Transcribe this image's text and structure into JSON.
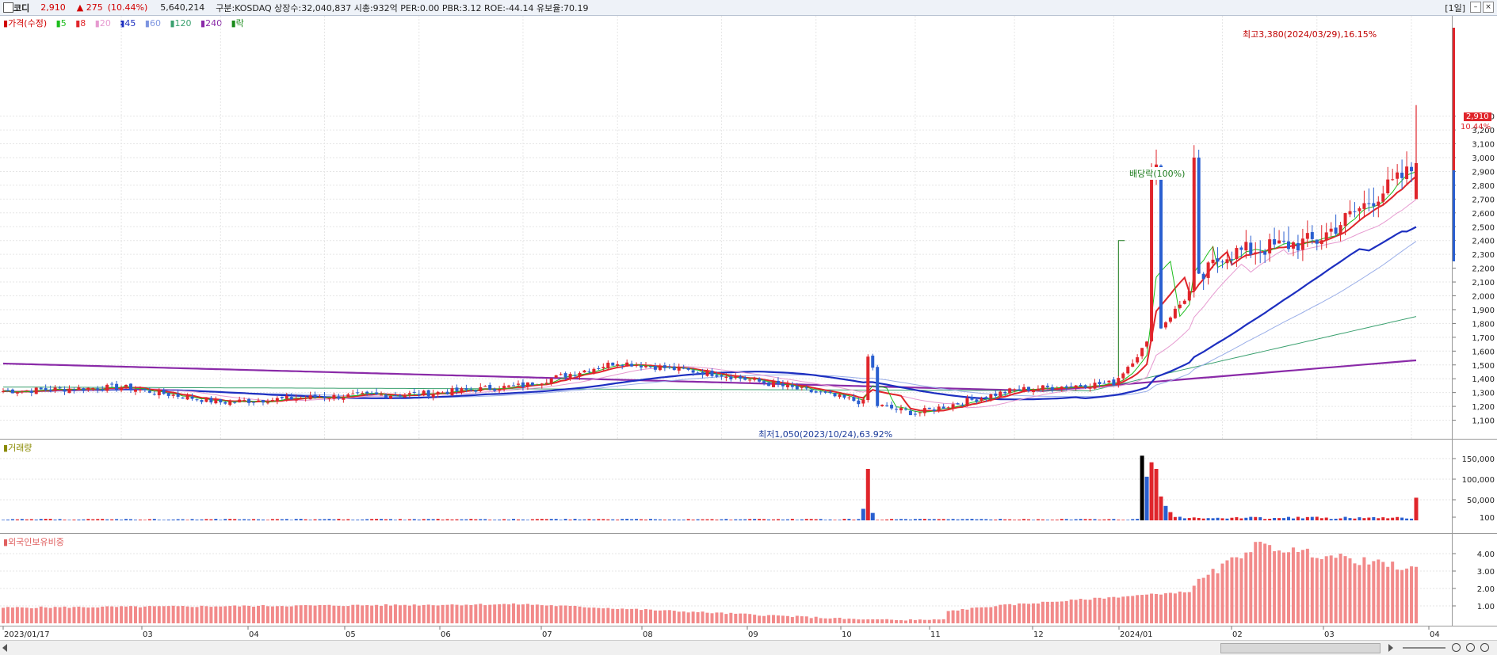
{
  "window": {
    "name": "코디",
    "price": "2,910",
    "change": "▲ 275",
    "change_pct": "(10.44%)",
    "volume": "5,640,214",
    "info": "구분:KOSDAQ 상장수:32,040,837 시총:932억 PER:0.00 PBR:3.12 ROE:-44.14 유보율:70.19",
    "period_button": "[1일]"
  },
  "legend": {
    "price_label": "가격(수정)",
    "ma": [
      {
        "label": "5",
        "color": "#1cbd1c"
      },
      {
        "label": "8",
        "color": "#e0252b"
      },
      {
        "label": "20",
        "color": "#e69ad0"
      },
      {
        "label": "45",
        "color": "#1d2fc0"
      },
      {
        "label": "60",
        "color": "#9aaee8"
      },
      {
        "label": "120",
        "color": "#3aa06f"
      },
      {
        "label": "240",
        "color": "#8a2aa8"
      }
    ],
    "ex_label": "락",
    "volume_label": "거래량",
    "foreign_label": "외국인보유비중"
  },
  "annotations": {
    "high": "최고3,380(2024/03/29),16.15%",
    "low": "최저1,050(2023/10/24),63.92%",
    "dividend": "배당락(100%)",
    "current_price": "2,910",
    "current_pct": "10.44%"
  },
  "x_labels": [
    "2023/01/17",
    "03",
    "04",
    "05",
    "06",
    "07",
    "08",
    "09",
    "10",
    "11",
    "12",
    "2024/01",
    "02",
    "03",
    "04"
  ],
  "colors": {
    "up": "#e0252b",
    "down": "#2a5fd0",
    "volume_spike": "#000000",
    "foreign_bar": "#f28a8a"
  },
  "chart_data": [
    {
      "type": "candlestick",
      "title": "가격(수정)",
      "ylim": [
        1050,
        3400
      ],
      "y_ticks": [
        1100,
        1200,
        1300,
        1400,
        1500,
        1600,
        1700,
        1800,
        1900,
        2000,
        2100,
        2200,
        2300,
        2400,
        2500,
        2600,
        2700,
        2800,
        2900,
        3000,
        3100,
        3200,
        3300
      ],
      "y_tick_labels": [
        "1,100",
        "1,200",
        "1,300",
        "1,400",
        "1,500",
        "1,600",
        "1,700",
        "1,800",
        "1,900",
        "2,000",
        "2,100",
        "2,200",
        "2,300",
        "2,400",
        "2,500",
        "2,600",
        "2,700",
        "2,800",
        "2,900",
        "3,000",
        "3,100",
        "3,200",
        "3,300"
      ],
      "x_range": [
        "2023/01/17",
        "2024/04"
      ],
      "close_approx": [
        [
          "2023-01",
          1310
        ],
        [
          "2023-02",
          1340
        ],
        [
          "2023-03",
          1230
        ],
        [
          "2023-04",
          1270
        ],
        [
          "2023-05",
          1290
        ],
        [
          "2023-06",
          1350
        ],
        [
          "2023-07",
          1520
        ],
        [
          "2023-08",
          1430
        ],
        [
          "2023-09",
          1300
        ],
        [
          "2023-10",
          1150
        ],
        [
          "2023-11",
          1320
        ],
        [
          "2023-12",
          1370
        ],
        [
          "2024-01",
          2300
        ],
        [
          "2024-02",
          2400
        ],
        [
          "2024-03",
          2910
        ]
      ],
      "ma_endpoints": {
        "45": 2490,
        "120": 1840,
        "240": 1590
      },
      "high": 3380,
      "low": 1050,
      "last_close": 2910
    },
    {
      "type": "bar",
      "title": "거래량",
      "ylim": [
        0,
        165000
      ],
      "y_ticks": [
        100,
        50000,
        100000,
        150000
      ],
      "y_tick_labels": [
        "100",
        "50,000",
        "100,000",
        "150,000"
      ],
      "spikes": [
        [
          "2023-09",
          125000
        ],
        [
          "2024-01",
          157000
        ],
        [
          "2024-01",
          141000
        ],
        [
          "2024-01",
          106000
        ],
        [
          "2024-03-29",
          55000
        ]
      ]
    },
    {
      "type": "bar",
      "title": "외국인보유비중",
      "ylim": [
        0,
        5.0
      ],
      "y_ticks": [
        1,
        2,
        3,
        4
      ],
      "y_tick_labels": [
        "1.00",
        "2.00",
        "3.00",
        "4.00"
      ],
      "series_approx": [
        [
          "2023-01",
          0.9
        ],
        [
          "2023-06",
          1.1
        ],
        [
          "2023-09",
          0.2
        ],
        [
          "2023-11",
          1.0
        ],
        [
          "2024-01",
          1.8
        ],
        [
          "2024-02",
          4.5
        ],
        [
          "2024-03",
          3.1
        ]
      ]
    }
  ]
}
